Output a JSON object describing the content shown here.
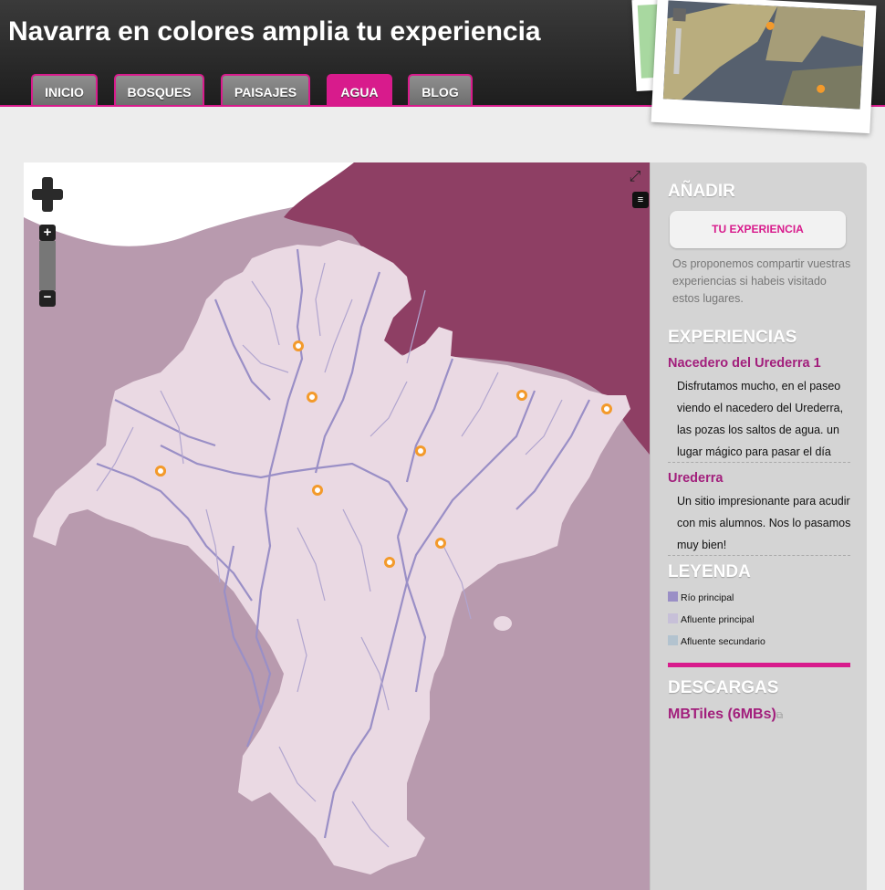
{
  "header": {
    "title": "Navarra en colores amplia tu experiencia",
    "nav": [
      {
        "label": "INICIO",
        "active": false
      },
      {
        "label": "BOSQUES",
        "active": false
      },
      {
        "label": "PAISAJES",
        "active": false
      },
      {
        "label": "AGUA",
        "active": true
      },
      {
        "label": "BLOG",
        "active": false
      }
    ]
  },
  "map": {
    "controls": {
      "zoom_in": "+",
      "zoom_out": "−",
      "fullscreen_icon": "fullscreen-icon",
      "layers_icon": "layers-icon"
    },
    "colors": {
      "land": "#ead9e3",
      "outside": "#b89aae",
      "neighbor": "#8e3f64",
      "sea": "#ffffff",
      "river": "#9a8fc6",
      "marker": "#f39a2b"
    },
    "marker_count": 10
  },
  "sidebar": {
    "add": {
      "heading": "AÑADIR",
      "button": "TU EXPERIENCIA",
      "description": "Os proponemos compartir vuestras experiencias si habeis visitado estos lugares."
    },
    "experiences": {
      "heading": "EXPERIENCIAS",
      "items": [
        {
          "title": "Nacedero del Urederra 1",
          "body": "Disfrutamos mucho, en el paseo viendo el nacedero del Urederra, las pozas los saltos de agua. un lugar mágico para pasar el día"
        },
        {
          "title": "Urederra",
          "body": "Un sitio impresionante para acudir con mis alumnos. Nos lo pasamos muy bien!"
        }
      ]
    },
    "legend": {
      "heading": "LEYENDA",
      "items": [
        {
          "label": "Río principal",
          "color": "#9a8fc6"
        },
        {
          "label": "Afluente principal",
          "color": "#c7c0d8"
        },
        {
          "label": "Afluente secundario",
          "color": "#b3c3cf"
        }
      ]
    },
    "downloads": {
      "heading": "DESCARGAS",
      "link": "MBTiles (6MBs)"
    }
  }
}
